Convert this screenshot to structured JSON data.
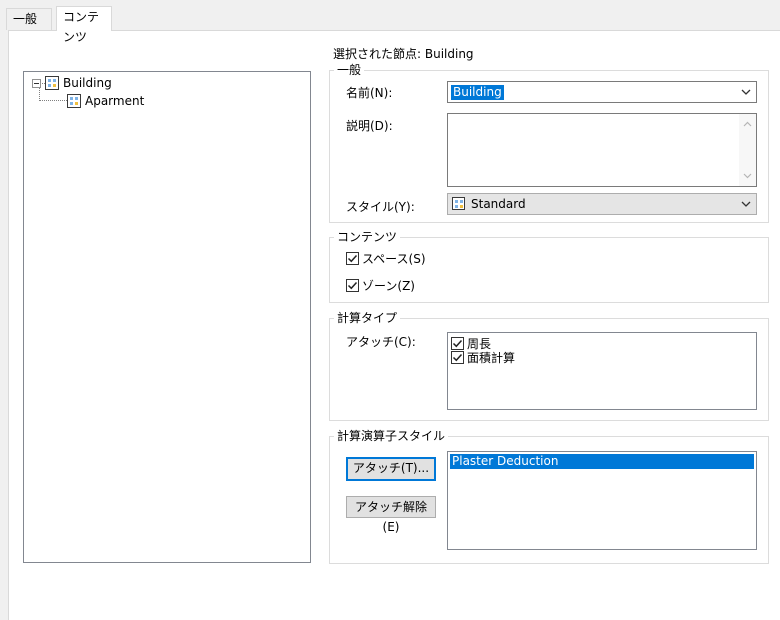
{
  "tabs": [
    {
      "label": "一般",
      "active": false
    },
    {
      "label": "コンテンツ",
      "active": true
    }
  ],
  "tree": {
    "root": {
      "label": "Building",
      "expanded": true
    },
    "children": [
      {
        "label": "Aparment"
      }
    ]
  },
  "selected_node_text": "選択された節点: Building",
  "general": {
    "title": "一般",
    "name_label": "名前(N):",
    "name_value": "Building",
    "desc_label": "説明(D):",
    "desc_value": "",
    "style_label": "スタイル(Y):",
    "style_value": "Standard"
  },
  "contents": {
    "title": "コンテンツ",
    "spaces": {
      "label": "スペース(S)",
      "checked": true
    },
    "zones": {
      "label": "ゾーン(Z)",
      "checked": true
    }
  },
  "calc_type": {
    "title": "計算タイプ",
    "attach_label": "アタッチ(C):",
    "items": [
      {
        "label": "周長",
        "checked": true
      },
      {
        "label": "面積計算",
        "checked": true
      }
    ]
  },
  "calc_modifier": {
    "title": "計算演算子スタイル",
    "attach_button": "アタッチ(T)...",
    "detach_button": "アタッチ解除(E)",
    "items": [
      {
        "label": "Plaster Deduction",
        "selected": true
      }
    ]
  },
  "colors": {
    "accent": "#0078d7",
    "panel": "#f0f0f0",
    "border": "#828790"
  }
}
